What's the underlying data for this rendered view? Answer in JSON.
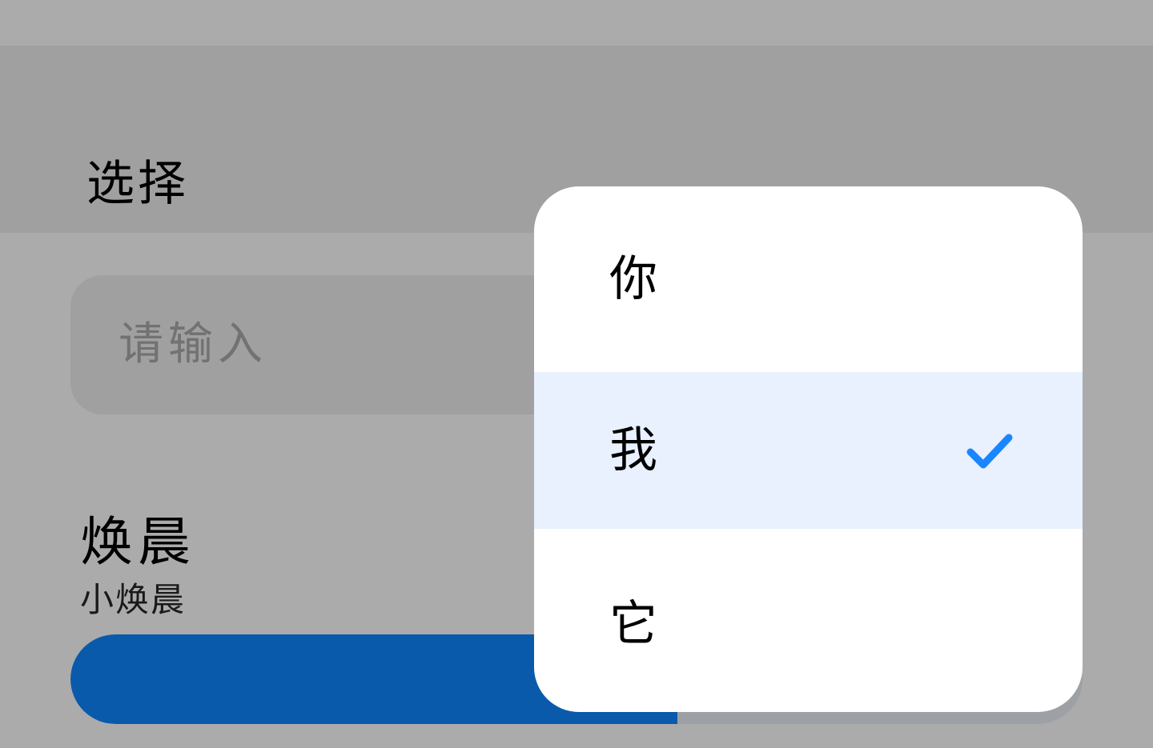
{
  "app_bar": {
    "title": "选择"
  },
  "search": {
    "placeholder": "请输入"
  },
  "list_item": {
    "title": "焕晨",
    "subtitle": "小焕晨"
  },
  "progress": {
    "value_fraction": 0.6
  },
  "popup_menu": {
    "items": [
      {
        "label": "你",
        "selected": false
      },
      {
        "label": "我",
        "selected": true
      },
      {
        "label": "它",
        "selected": false
      }
    ],
    "selected_icon": "check-icon"
  },
  "colors": {
    "accent": "#1a85ff",
    "progress_fill": "#0a5aab",
    "scrim": "#ababab",
    "selected_item_bg": "#e8f1fd"
  }
}
